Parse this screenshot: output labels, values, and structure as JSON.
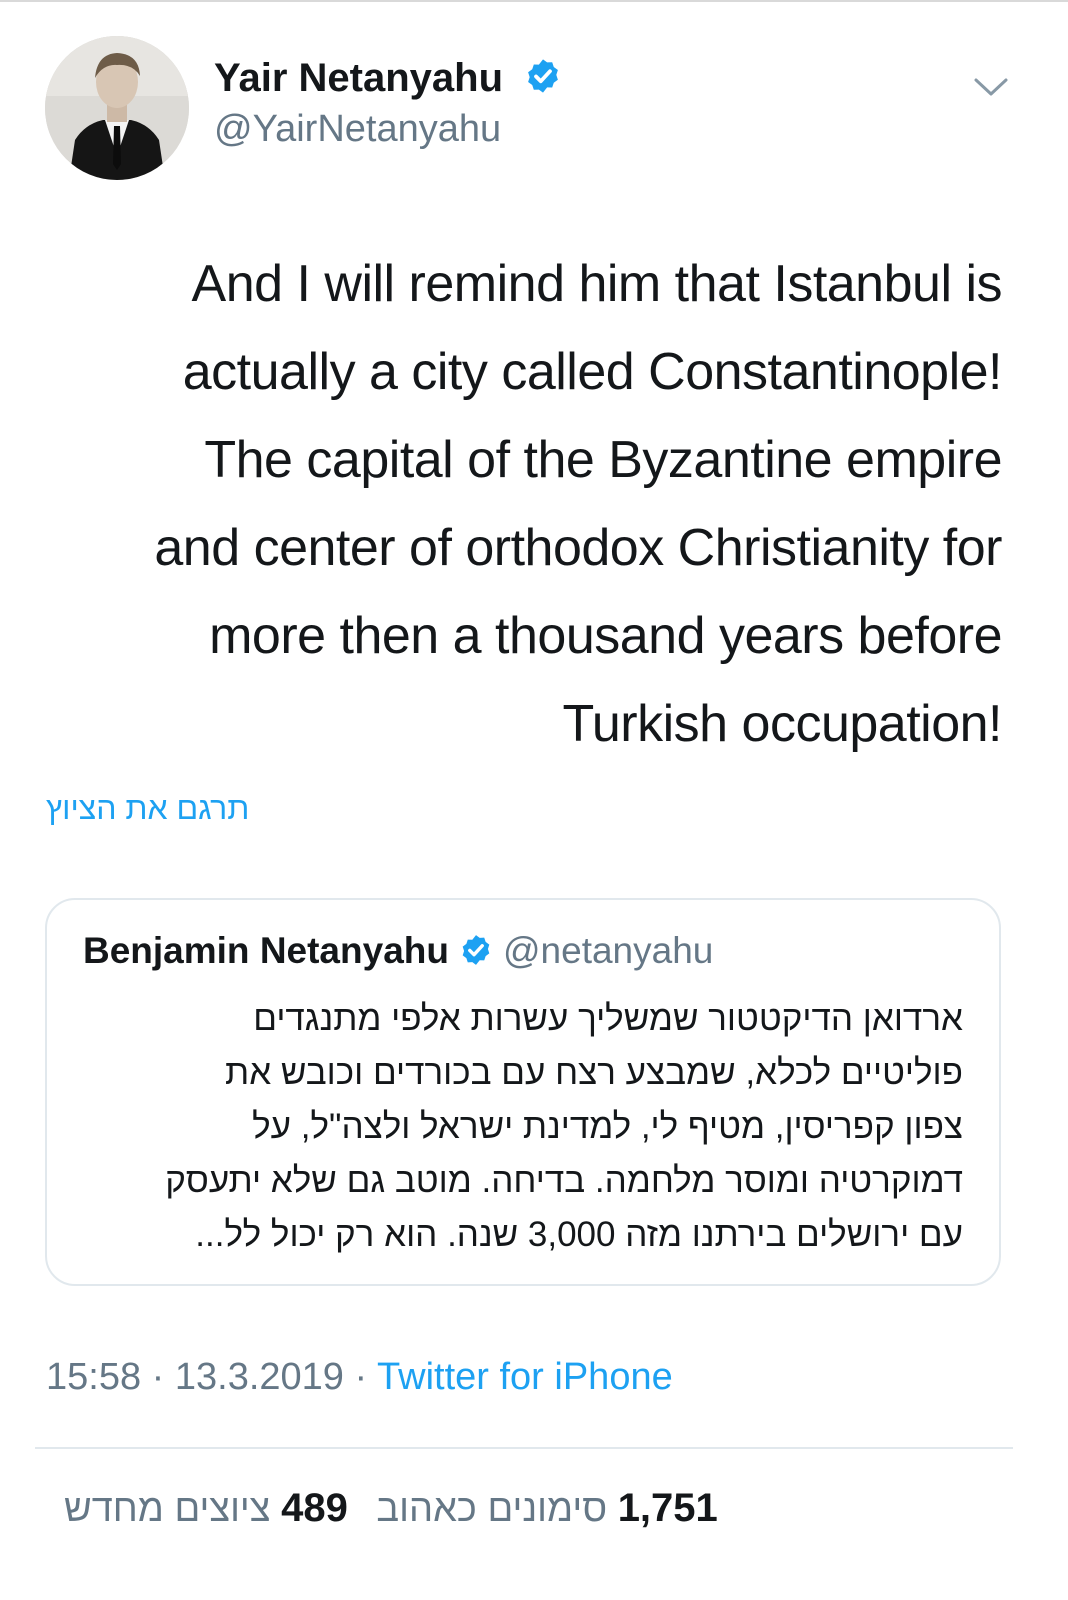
{
  "author": {
    "display_name": "Yair Netanyahu",
    "handle": "@YairNetanyahu",
    "verified_icon": "verified-badge-icon"
  },
  "menu_icon": "chevron-down-icon",
  "tweet": {
    "lines": [
      "And I will remind him that Istanbul is",
      "actually a city called Constantinople!",
      "The capital of the Byzantine empire",
      "and center of orthodox Christianity for",
      "more then a thousand years before",
      "Turkish occupation!"
    ],
    "translate_link": "תרגם את הציוץ"
  },
  "quoted_tweet": {
    "display_name": "Benjamin Netanyahu",
    "handle": "@netanyahu",
    "lines": [
      "ארדואן הדיקטטור שמשליך עשרות אלפי מתנגדים",
      "פוליטיים לכלא, שמבצע רצח עם בכורדים וכובש את",
      "צפון קפריסין, מטיף לי, למדינת ישראל ולצה\"ל, על",
      "דמוקרטיה ומוסר מלחמה. בדיחה. מוטב גם שלא יתעסק",
      "עם ירושלים בירתנו מזה 3,000 שנה. הוא רק יכול לל..."
    ]
  },
  "meta": {
    "time": "15:58",
    "separator": " · ",
    "date": "13.3.2019",
    "source": "Twitter for iPhone"
  },
  "stats": {
    "likes_count": "1,751",
    "likes_label": "סימונים כאהוב",
    "retweets_count": "489",
    "retweets_label": "ציוצים מחדש"
  },
  "colors": {
    "accent": "#1da1f2",
    "text": "#14171a",
    "secondary": "#657786",
    "border": "#e1e8ed"
  }
}
